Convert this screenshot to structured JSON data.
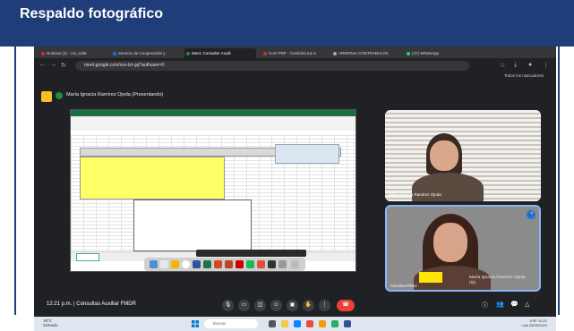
{
  "slide": {
    "title": "Respaldo fotográfico"
  },
  "browser": {
    "tabs": [
      {
        "label": "Noticias (2) - col_cdiat",
        "color": "#d93025"
      },
      {
        "label": "Servicio de Cooperación y",
        "color": "#1a73e8"
      },
      {
        "label": "Meet: Consultor Auxili",
        "color": "#1e8e3e"
      },
      {
        "label": "Com PDF - Combina tus a",
        "color": "#d93025"
      },
      {
        "label": "ARMONIA CONTRABALOC",
        "color": "#aaaaaa"
      },
      {
        "label": "(47) WhatsApp",
        "color": "#25d366"
      }
    ],
    "url": "meet.google.com/xxx-tzt-gq?authuser=0",
    "bookmarks_right": "Todos los marcadores"
  },
  "meet": {
    "presenter": "María Ignacia Ramírez Ojeda (Presentando)",
    "participant_top_name": "María Ignacia Ramírez Ojeda",
    "participant_bottom_name": "Carolina Pérez",
    "sidebar_name": "María Ignacia Ramírez Ojeda",
    "sidebar_sub": "(tú)",
    "time": "12:21 p.m.",
    "meeting_name": "Consultas Auxiliar FMDR",
    "time_sep": "|"
  },
  "icons": {
    "back": "arrow-left-icon",
    "forward": "arrow-right-icon",
    "reload": "reload-icon",
    "mic": "microphone-icon",
    "cam": "camera-icon",
    "hangup": "phone-hangup-icon",
    "info": "info-icon",
    "people": "people-icon",
    "chat": "chat-icon"
  },
  "taskbar": {
    "weather_temp": "19°C",
    "weather_desc": "Soleado",
    "search_placeholder": "Buscar",
    "lang": "ESP",
    "lang_sub": "LAA",
    "clock_time": "12:21",
    "clock_date": "25/09/2024"
  },
  "colors": {
    "header": "#1f3d78",
    "meet_bg": "#202124",
    "hangup": "#ea4335",
    "accent": "#8ab4f8"
  }
}
